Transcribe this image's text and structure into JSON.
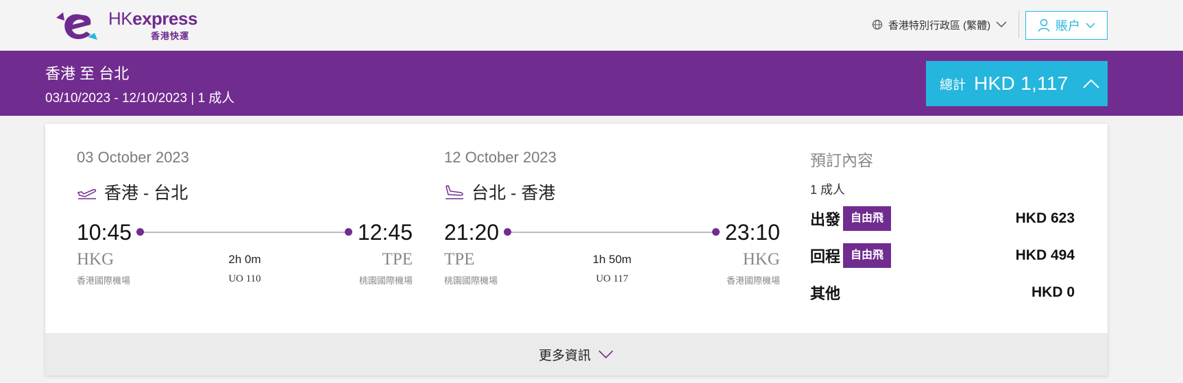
{
  "header": {
    "logo_en_hk": "HK",
    "logo_en_express": "express",
    "logo_zh": "香港快運",
    "language_label": "香港特別行政區 (繁體)",
    "account_label": "賬户"
  },
  "summary_bar": {
    "route": "香港 至 台北",
    "dates": "03/10/2023 - 12/10/2023 | 1 成人",
    "total_label": "總計",
    "total_value": "HKD 1,117"
  },
  "legs": [
    {
      "date": "03 October 2023",
      "route": "香港 - 台北",
      "depart_time": "10:45",
      "arrive_time": "12:45",
      "from_code": "HKG",
      "to_code": "TPE",
      "duration": "2h 0m",
      "flight_no": "UO 110",
      "from_name": "香港國際機場",
      "to_name": "桃園國際機場"
    },
    {
      "date": "12 October 2023",
      "route": "台北 - 香港",
      "depart_time": "21:20",
      "arrive_time": "23:10",
      "from_code": "TPE",
      "to_code": "HKG",
      "duration": "1h 50m",
      "flight_no": "UO 117",
      "from_name": "桃園國際機場",
      "to_name": "香港國際機場"
    }
  ],
  "booking": {
    "title": "預訂內容",
    "passengers": "1 成人",
    "rows": [
      {
        "label": "出發",
        "badge": "自由飛",
        "amount": "HKD 623"
      },
      {
        "label": "回程",
        "badge": "自由飛",
        "amount": "HKD 494"
      },
      {
        "label": "其他",
        "badge": "",
        "amount": "HKD 0"
      }
    ]
  },
  "more_info_label": "更多資訊",
  "colors": {
    "brand_purple": "#712c8f",
    "accent_cyan": "#25b6de"
  }
}
